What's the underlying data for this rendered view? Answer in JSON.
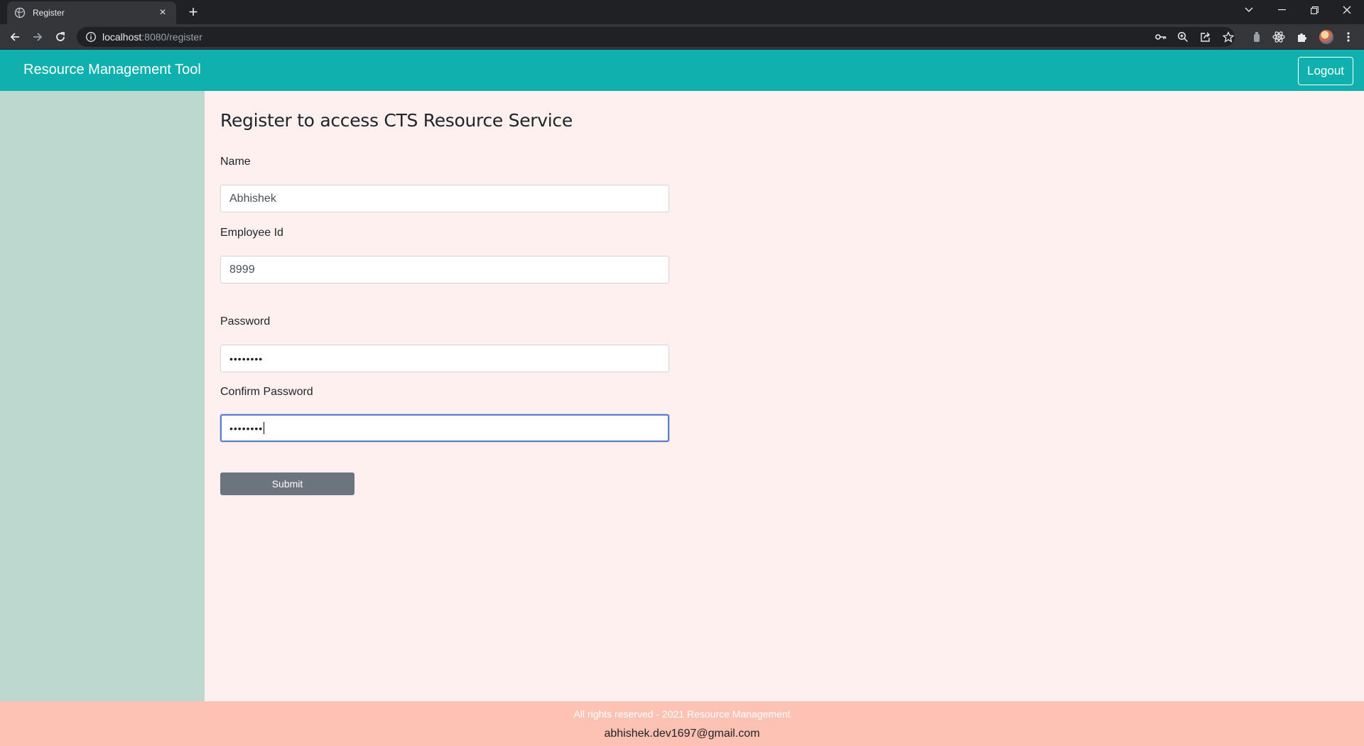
{
  "browser": {
    "tab_title": "Register",
    "tab_close": "×",
    "new_tab": "+",
    "url_host": "localhost",
    "url_path": ":8080/register"
  },
  "header": {
    "brand": "Resource Management Tool",
    "logout_label": "Logout",
    "color": "#0fb0ad"
  },
  "form": {
    "title": "Register to access CTS Resource Service",
    "name_label": "Name",
    "name_value": "Abhishek",
    "employee_id_label": "Employee Id",
    "employee_id_value": "8999",
    "password_label": "Password",
    "password_masked": "••••••••",
    "confirm_password_label": "Confirm Password",
    "confirm_password_masked": "••••••••",
    "submit_label": "Submit"
  },
  "footer": {
    "rights": "All rights reserved - 2021 Resource Management",
    "email": "abhishek.dev1697@gmail.com"
  },
  "colors": {
    "sidebar": "#bdd9cf",
    "main_bg": "#fff0f0",
    "footer_bg": "#fdc2b4",
    "submit_bg": "#6c757d"
  }
}
